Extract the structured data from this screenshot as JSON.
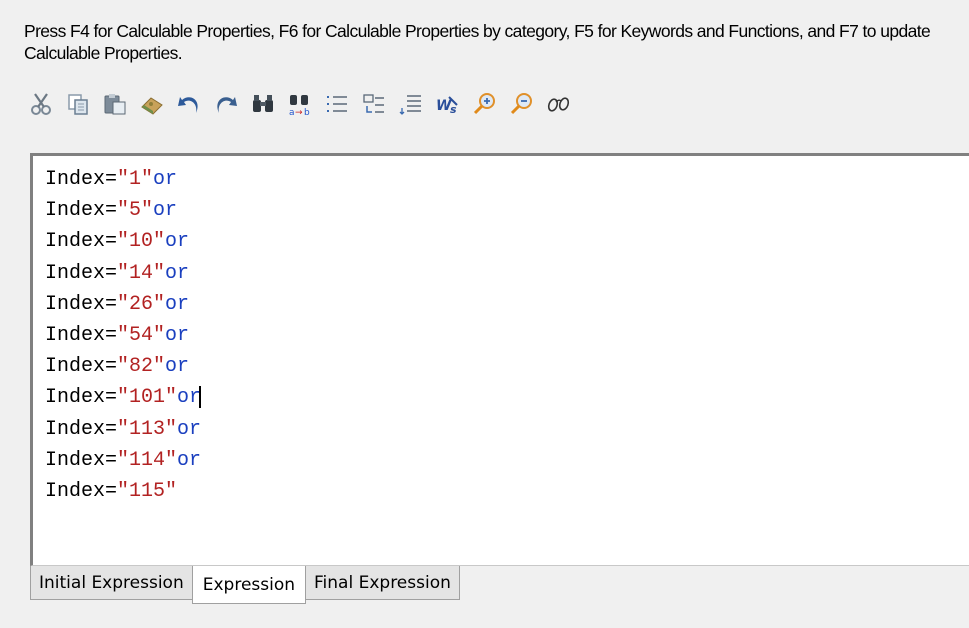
{
  "hint_text": "Press F4 for Calculable Properties, F6 for Calculable Properties by category, F5 for Keywords and Functions, and F7 to update Calculable Properties.",
  "toolbar": [
    {
      "name": "cut-icon",
      "label": "Cut"
    },
    {
      "name": "copy-icon",
      "label": "Copy"
    },
    {
      "name": "paste-icon",
      "label": "Paste"
    },
    {
      "name": "eraser-icon",
      "label": "Clear"
    },
    {
      "name": "undo-icon",
      "label": "Undo"
    },
    {
      "name": "redo-icon",
      "label": "Redo"
    },
    {
      "name": "find-icon",
      "label": "Find"
    },
    {
      "name": "replace-icon",
      "label": "Replace"
    },
    {
      "name": "indent-list-icon",
      "label": "Indent"
    },
    {
      "name": "outdent-list-icon",
      "label": "Outdent"
    },
    {
      "name": "line-numbers-icon",
      "label": "Line numbers"
    },
    {
      "name": "word-wrap-icon",
      "label": "Word wrap"
    },
    {
      "name": "zoom-in-icon",
      "label": "Zoom in"
    },
    {
      "name": "zoom-out-icon",
      "label": "Zoom out"
    },
    {
      "name": "glasses-icon",
      "label": "View"
    }
  ],
  "colors": {
    "string": "#b22222",
    "keyword": "#1a3fbf",
    "text": "#000000"
  },
  "expression_lines": [
    {
      "field": "Index",
      "op": "=",
      "value": "\"1\"",
      "suffix": "or"
    },
    {
      "field": "Index",
      "op": "=",
      "value": "\"5\"",
      "suffix": "or"
    },
    {
      "field": "Index",
      "op": "=",
      "value": "\"10\"",
      "suffix": "or"
    },
    {
      "field": "Index",
      "op": "=",
      "value": "\"14\"",
      "suffix": "or"
    },
    {
      "field": "Index",
      "op": "=",
      "value": "\"26\"",
      "suffix": "or"
    },
    {
      "field": "Index",
      "op": "=",
      "value": "\"54\"",
      "suffix": "or"
    },
    {
      "field": "Index",
      "op": "=",
      "value": "\"82\"",
      "suffix": "or"
    },
    {
      "field": "Index",
      "op": "=",
      "value": "\"101\"",
      "suffix": "or"
    },
    {
      "field": "Index",
      "op": "=",
      "value": "\"113\"",
      "suffix": "or"
    },
    {
      "field": "Index",
      "op": "=",
      "value": "\"114\"",
      "suffix": "or"
    },
    {
      "field": "Index",
      "op": "=",
      "value": "\"115\"",
      "suffix": ""
    }
  ],
  "caret_line": 7,
  "tabs": [
    {
      "label": "Initial Expression",
      "active": false
    },
    {
      "label": "Expression",
      "active": true
    },
    {
      "label": "Final Expression",
      "active": false
    }
  ]
}
